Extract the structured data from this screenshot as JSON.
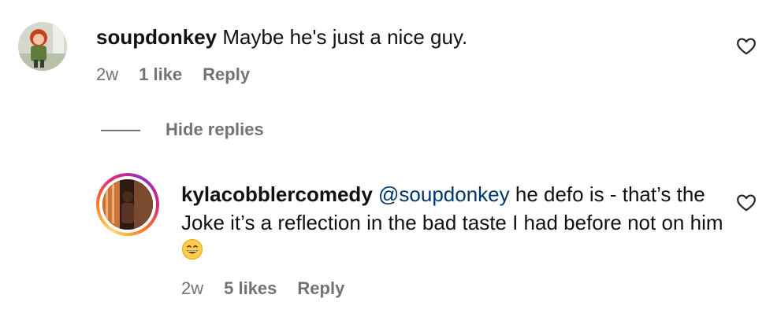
{
  "comments": [
    {
      "username": "soupdonkey",
      "text": " Maybe he's just a nice guy.",
      "age": "2w",
      "likes": "1 like",
      "reply_label": "Reply",
      "avatar_icon": "user-avatar-icon",
      "like_icon": "heart-outline-icon"
    },
    {
      "username": "kylacobblercomedy",
      "mention": "@soupdonkey",
      "text": " he defo is - that’s the Joke it’s a reflection in the bad taste I had before not on him ",
      "emoji_icon": "grinning-face-emoji",
      "age": "2w",
      "likes": "5 likes",
      "reply_label": "Reply",
      "avatar_icon": "user-avatar-icon",
      "like_icon": "heart-outline-icon"
    }
  ],
  "hide_replies_label": "Hide replies",
  "colors": {
    "text": "#111111",
    "meta": "#737373",
    "mention": "#00376b",
    "story_ring": [
      "#feda75",
      "#fa7e1e",
      "#d62976",
      "#962fbf"
    ]
  }
}
